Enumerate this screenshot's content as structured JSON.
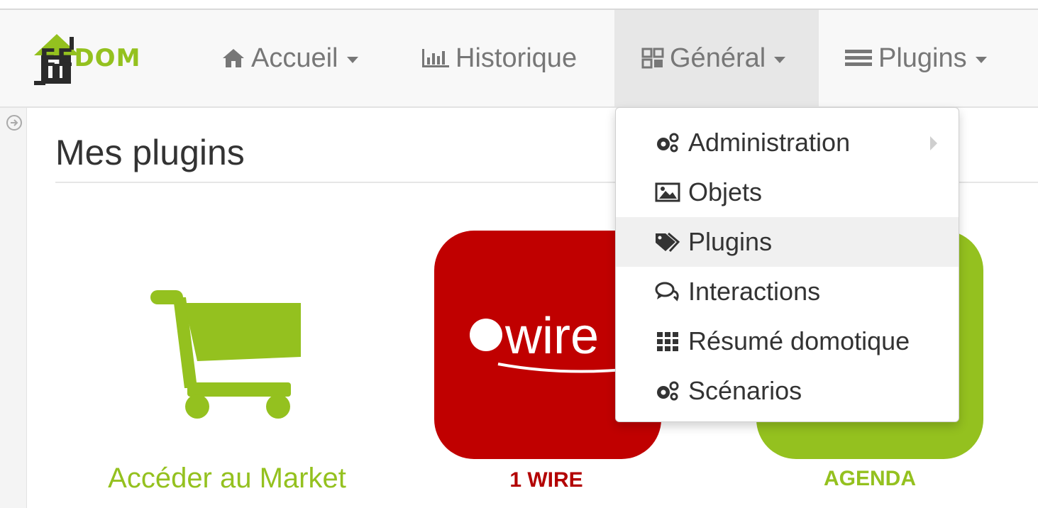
{
  "brand": {
    "logo_prefix": "EE",
    "logo_suffix": "DOM",
    "accent_color": "#94c11f"
  },
  "navbar": {
    "items": [
      {
        "label": "Accueil",
        "icon": "home-icon",
        "has_caret": true
      },
      {
        "label": "Historique",
        "icon": "bar-chart-icon",
        "has_caret": false
      },
      {
        "label": "Général",
        "icon": "grid-icon",
        "has_caret": true,
        "active": true
      },
      {
        "label": "Plugins",
        "icon": "list-icon",
        "has_caret": true
      }
    ]
  },
  "dropdown": {
    "items": [
      {
        "label": "Administration",
        "icon": "cogs-icon",
        "has_submenu": true
      },
      {
        "label": "Objets",
        "icon": "picture-icon"
      },
      {
        "label": "Plugins",
        "icon": "tags-icon",
        "highlighted": true
      },
      {
        "label": "Interactions",
        "icon": "comments-icon"
      },
      {
        "label": "Résumé domotique",
        "icon": "th-icon"
      },
      {
        "label": "Scénarios",
        "icon": "cogs-icon"
      }
    ]
  },
  "page": {
    "title": "Mes plugins"
  },
  "plugins": {
    "market_label": "Accéder au Market",
    "wire_label": "1 WIRE",
    "wire_logo_text": "wire",
    "agenda_label": "AGENDA",
    "wire_color": "#c00000",
    "agenda_color": "#94c11f"
  }
}
